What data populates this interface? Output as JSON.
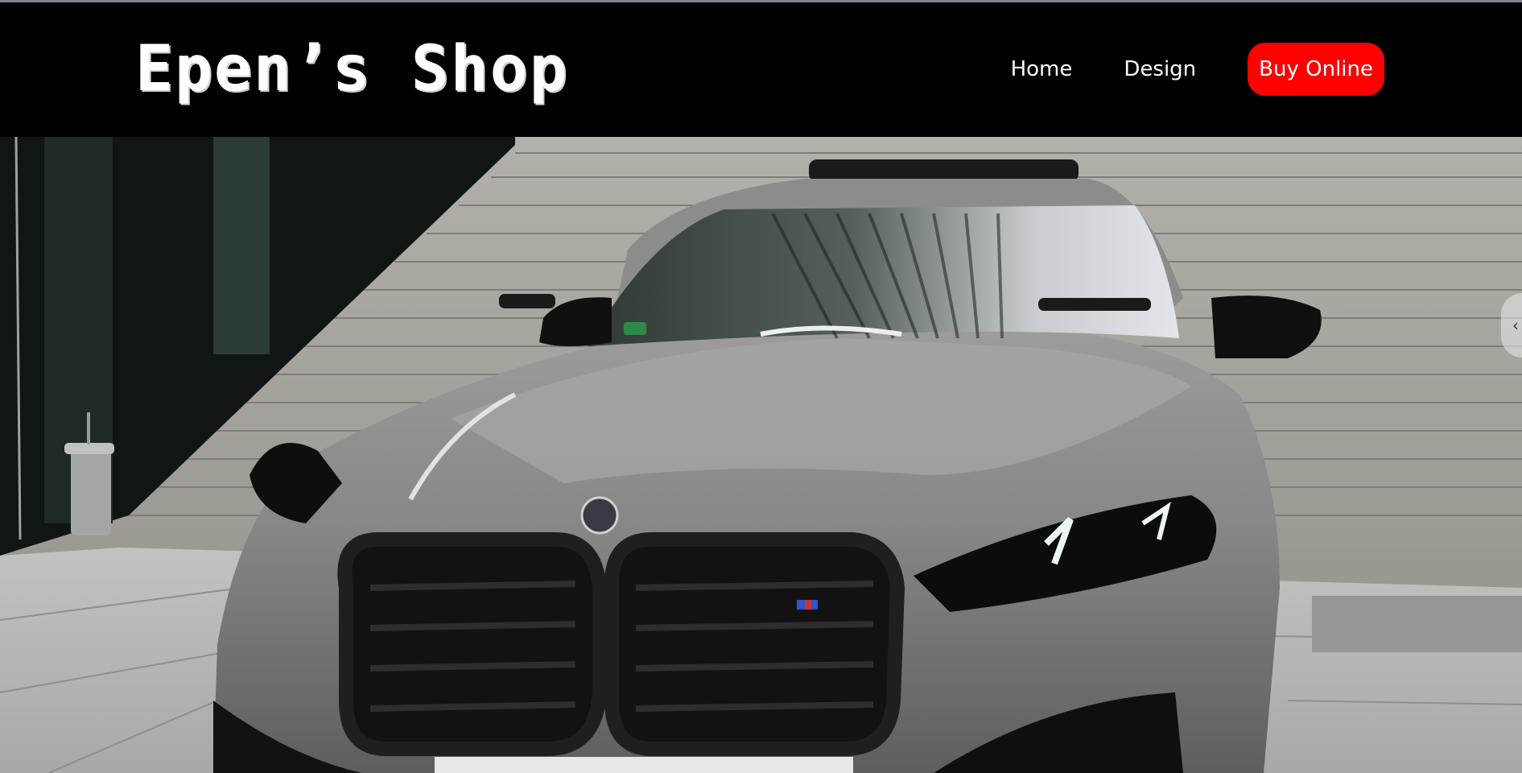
{
  "header": {
    "logo_text": "Epen’s Shop"
  },
  "nav": {
    "items": [
      {
        "label": "Home"
      },
      {
        "label": "Design"
      }
    ],
    "cta_label": "Buy Online"
  },
  "hero": {
    "image": "car-photo",
    "scroll_icon": "chevron-left-icon"
  },
  "colors": {
    "header_bg": "#000000",
    "cta_bg": "#ff0000",
    "text": "#ffffff"
  }
}
